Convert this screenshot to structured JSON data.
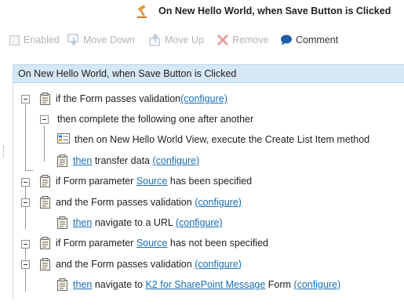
{
  "window": {
    "title": "On New Hello World, when Save Button is Clicked",
    "title_icon": "hammer-icon"
  },
  "toolbar": {
    "enabled_label": "Enabled",
    "move_down_label": "Move Down",
    "move_up_label": "Move Up",
    "remove_label": "Remove",
    "comment_label": "Comment"
  },
  "rule": {
    "header": "On New Hello World, when Save Button is Clicked",
    "rows": [
      {
        "parts": [
          "if the Form passes validation ",
          "(configure)"
        ]
      },
      {
        "parts": [
          "then complete the following one after another"
        ]
      },
      {
        "parts": [
          "then on New Hello World View, execute the Create List Item method"
        ]
      },
      {
        "parts": [
          "then",
          " transfer data ",
          "(configure)"
        ]
      },
      {
        "parts": [
          "if Form parameter ",
          "Source",
          " has been specified"
        ]
      },
      {
        "parts": [
          "and the Form passes validation ",
          "(configure)"
        ]
      },
      {
        "parts": [
          "then",
          " navigate to a URL ",
          "(configure)"
        ]
      },
      {
        "parts": [
          "if Form parameter ",
          "Source",
          " has not been specified"
        ]
      },
      {
        "parts": [
          "and the Form passes validation ",
          "(configure)"
        ]
      },
      {
        "parts": [
          "then",
          " navigate to ",
          "K2 for SharePoint Message",
          " Form ",
          "(configure)"
        ]
      }
    ]
  },
  "colors": {
    "header_bg": "#d6e8f5",
    "link": "#1a6fb5",
    "remove_icon": "#e8a0a0",
    "comment_icon": "#1f5fa6"
  }
}
